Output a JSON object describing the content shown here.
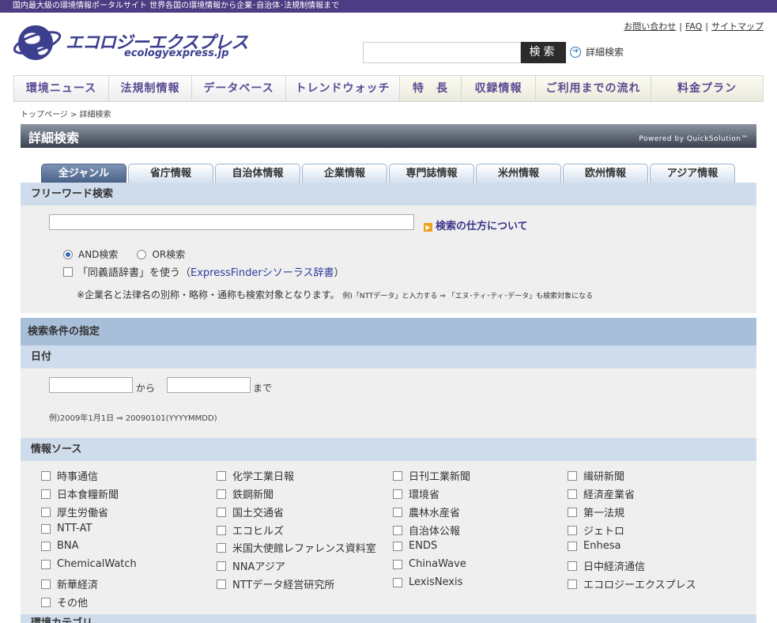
{
  "topbar": {
    "tagline": "国内最大級の環境情報ポータルサイト 世界各国の環境情報から企業･自治体･法規制情報まで"
  },
  "logo": {
    "jp": "エコロジーエクスプレス",
    "en": "ecologyexpress.jp"
  },
  "util_links": {
    "contact": "お問い合わせ",
    "faq": "FAQ",
    "sitemap": "サイトマップ",
    "sep": "|"
  },
  "search": {
    "value": "",
    "button": "検索",
    "advanced": "詳細検索"
  },
  "gnav": [
    "環境ニュース",
    "法規制情報",
    "データベース",
    "トレンドウォッチ",
    "特　長",
    "収録情報",
    "ご利用までの流れ",
    "料金プラン"
  ],
  "breadcrumb": "トップページ > 詳細検索",
  "title": {
    "heading": "詳細検索",
    "powered": "Powered by QuickSolution™"
  },
  "tabs": [
    "全ジャンル",
    "省庁情報",
    "自治体情報",
    "企業情報",
    "専門誌情報",
    "米州情報",
    "欧州情報",
    "アジア情報"
  ],
  "freeword": {
    "heading": "フリーワード検索",
    "value": "",
    "howto": "検索の仕方について",
    "and_label": "AND検索",
    "or_label": "OR検索",
    "syn_prefix": "「同義語辞書」を使う（",
    "syn_link": "ExpressFinderシソーラス辞書",
    "syn_suffix": "）",
    "note": "※企業名と法律名の別称・略称・通称も検索対象となります。",
    "note_small": "例)「NTTデータ」と入力する ⇒ 「エヌ･ティ･ティ･データ」も検索対象になる"
  },
  "conditions": {
    "heading": "検索条件の指定"
  },
  "date": {
    "heading": "日付",
    "from_label": "から",
    "to_label": "まで",
    "example": "例)2009年1月1日 ⇒ 20090101(YYYYMMDD)"
  },
  "sources": {
    "heading": "情報ソース",
    "items": [
      "時事通信",
      "化学工業日報",
      "日刊工業新聞",
      "繊研新聞",
      "日本食糧新聞",
      "鉄鋼新聞",
      "環境省",
      "経済産業省",
      "厚生労働省",
      "国土交通省",
      "農林水産省",
      "第一法規",
      "NTT-AT",
      "エコヒルズ",
      "自治体公報",
      "ジェトロ",
      "BNA",
      "米国大使館レファレンス資料室",
      "ENDS",
      "Enhesa",
      "ChemicalWatch",
      "NNAアジア",
      "ChinaWave",
      "日中経済通信",
      "新華経済",
      "NTTデータ経営研究所",
      "LexisNexis",
      "エコロジーエクスプレス",
      "その他"
    ]
  },
  "next_section": {
    "heading": "環境カテゴリ"
  },
  "colors": {
    "topbar": "#4b3c83",
    "nav_text": "#5b4a93",
    "tab_active": "#485f86",
    "section_bg": "#cfdcec",
    "panel_bg": "#efefef"
  }
}
